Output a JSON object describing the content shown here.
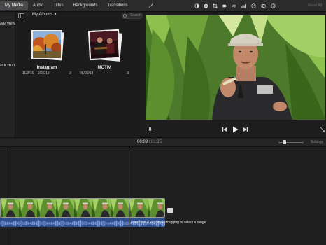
{
  "tabs": [
    {
      "label": "My Media",
      "active": true
    },
    {
      "label": "Audio",
      "active": false
    },
    {
      "label": "Titles",
      "active": false
    },
    {
      "label": "Backgrounds",
      "active": false
    },
    {
      "label": "Transitions",
      "active": false
    }
  ],
  "sidebar": {
    "items": [
      {
        "label": "Overview"
      },
      {
        "label": "Black Run"
      }
    ]
  },
  "library": {
    "albums_label": "My Albums",
    "search_placeholder": "Search",
    "albums": [
      {
        "title": "Instagram",
        "dates": "11/3/16 – 2/26/19",
        "count": "3"
      },
      {
        "title": "MOTIV",
        "dates": "06/29/18",
        "count": "3"
      }
    ]
  },
  "viewer": {
    "reset_label": "Reset All",
    "toolbar_icons": [
      "magic-wand-icon",
      "color-balance-icon",
      "color-correction-icon",
      "crop-icon",
      "stabilization-icon",
      "volume-icon",
      "equalizer-icon",
      "speed-icon",
      "filter-icon",
      "info-icon"
    ]
  },
  "timeline": {
    "current_time": "00:09",
    "separator": "/",
    "duration": "01:35",
    "settings_label": "Settings",
    "hint": "Press the R key while dragging to select a range",
    "zoom_level": 0.2
  },
  "colors": {
    "accent": "#3b6fd4",
    "audio_wave": "#2f4f8f",
    "panel": "#1e1e1f",
    "toolbar": "#2b2b2c"
  }
}
